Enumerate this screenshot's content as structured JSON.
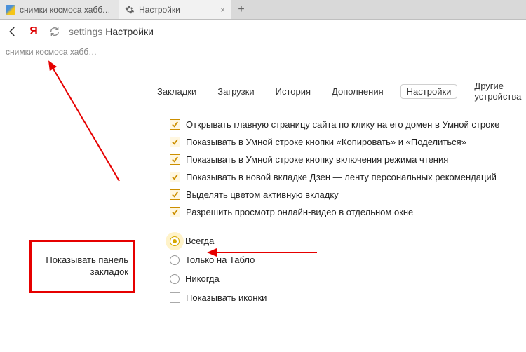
{
  "tabs": {
    "t0": {
      "title": "снимки космоса хаббл выс…"
    },
    "t1": {
      "title": "Настройки"
    }
  },
  "address": {
    "prefix": "settings",
    "path": "Настройки"
  },
  "bookmarkBar": {
    "item0": "снимки космоса хабб…"
  },
  "nav": {
    "bookmarks": "Закладки",
    "downloads": "Загрузки",
    "history": "История",
    "addons": "Дополнения",
    "settings": "Настройки",
    "devices": "Другие устройства"
  },
  "options": {
    "o0": "Открывать главную страницу сайта по клику на его домен в Умной строке",
    "o1": "Показывать в Умной строке кнопки «Копировать» и «Поделиться»",
    "o2": "Показывать в Умной строке кнопку включения режима чтения",
    "o3": "Показывать в новой вкладке Дзен — ленту персональных рекомендаций",
    "o4": "Выделять цветом активную вкладку",
    "o5": "Разрешить просмотр онлайн-видео в отдельном окне"
  },
  "sidebarLabel": "Показывать панель закладок",
  "radio": {
    "r0": "Всегда",
    "r1": "Только на Табло",
    "r2": "Никогда"
  },
  "extraOption": "Показывать иконки"
}
